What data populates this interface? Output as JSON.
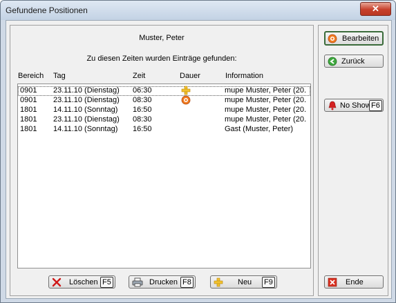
{
  "window": {
    "title": "Gefundene Positionen",
    "close": "✕"
  },
  "main": {
    "name": "Muster, Peter",
    "subtitle": "Zu diesen Zeiten wurden Einträge gefunden:",
    "columns": [
      "Bereich",
      "Tag",
      "Zeit",
      "Dauer",
      "Information"
    ],
    "rows": [
      {
        "bereich": "0901",
        "tag": "23.11.10 (Dienstag)",
        "zeit": "06:30",
        "info": "mupe  Muster, Peter (20.",
        "icon": "plus-icon"
      },
      {
        "bereich": "0901",
        "tag": "23.11.10 (Dienstag)",
        "zeit": "08:30",
        "info": "mupe  Muster, Peter (20.",
        "icon": "target-icon"
      },
      {
        "bereich": "1801",
        "tag": "14.11.10 (Sonntag)",
        "zeit": "16:50",
        "info": "mupe  Muster, Peter (20."
      },
      {
        "bereich": "1801",
        "tag": "23.11.10 (Dienstag)",
        "zeit": "08:30",
        "info": "mupe  Muster, Peter (20."
      },
      {
        "bereich": "1801",
        "tag": "14.11.10 (Sonntag)",
        "zeit": "16:50",
        "info": "Gast (Muster, Peter)"
      }
    ]
  },
  "buttons": {
    "loeschen": {
      "label": "Löschen",
      "key": "F5"
    },
    "drucken": {
      "label": "Drucken",
      "key": "F8"
    },
    "neu": {
      "label": "Neu",
      "key": "F9"
    },
    "bearbeiten": {
      "label": "Bearbeiten"
    },
    "zurueck": {
      "label": "Zurück"
    },
    "noshow": {
      "label": "No Show",
      "key": "F6"
    },
    "ende": {
      "label": "Ende"
    }
  }
}
